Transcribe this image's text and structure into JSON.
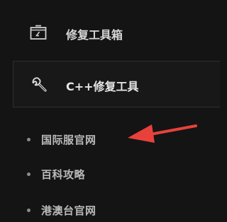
{
  "menu": {
    "toolbox": {
      "label": "修复工具箱",
      "icon": "toolbox-icon"
    },
    "cpp_repair": {
      "label": "C++修复工具",
      "icon": "wrench-icon"
    }
  },
  "submenu": {
    "items": [
      {
        "label": "国际服官网"
      },
      {
        "label": "百科攻略"
      },
      {
        "label": "港澳台官网"
      }
    ]
  },
  "annotation": {
    "arrow_color": "#e8413c"
  }
}
